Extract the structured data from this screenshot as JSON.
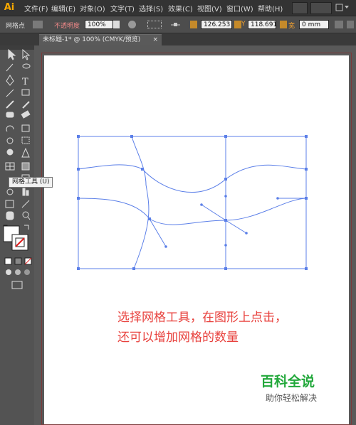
{
  "app": {
    "logo": "Ai"
  },
  "menu": [
    "文件(F)",
    "编辑(E)",
    "对象(O)",
    "文字(T)",
    "选择(S)",
    "效果(C)",
    "视图(V)",
    "窗口(W)",
    "帮助(H)"
  ],
  "control_bar": {
    "selection_label": "网格点",
    "opacity_label": "不透明度",
    "opacity_value": "100%",
    "x_label": "X",
    "x_value": "126.253",
    "y_label": "Y",
    "y_value": "118.691",
    "w_label": "宽",
    "w_value": "0 mm"
  },
  "document_tab": {
    "title": "未标题-1* @ 100% (CMYK/预览)",
    "close": "×"
  },
  "tooltip": {
    "text": "网格工具 (U)"
  },
  "annotation": {
    "line1": "选择网格工具，在图形上点击，",
    "line2": "还可以增加网格的数量"
  },
  "watermark": {
    "title": "百科全说",
    "subtitle": "助你轻松解决"
  },
  "colors": {
    "accent": "#f7a800",
    "mesh": "#5b7fe8",
    "annotation": "#e8413d",
    "watermark": "#22a83b"
  }
}
